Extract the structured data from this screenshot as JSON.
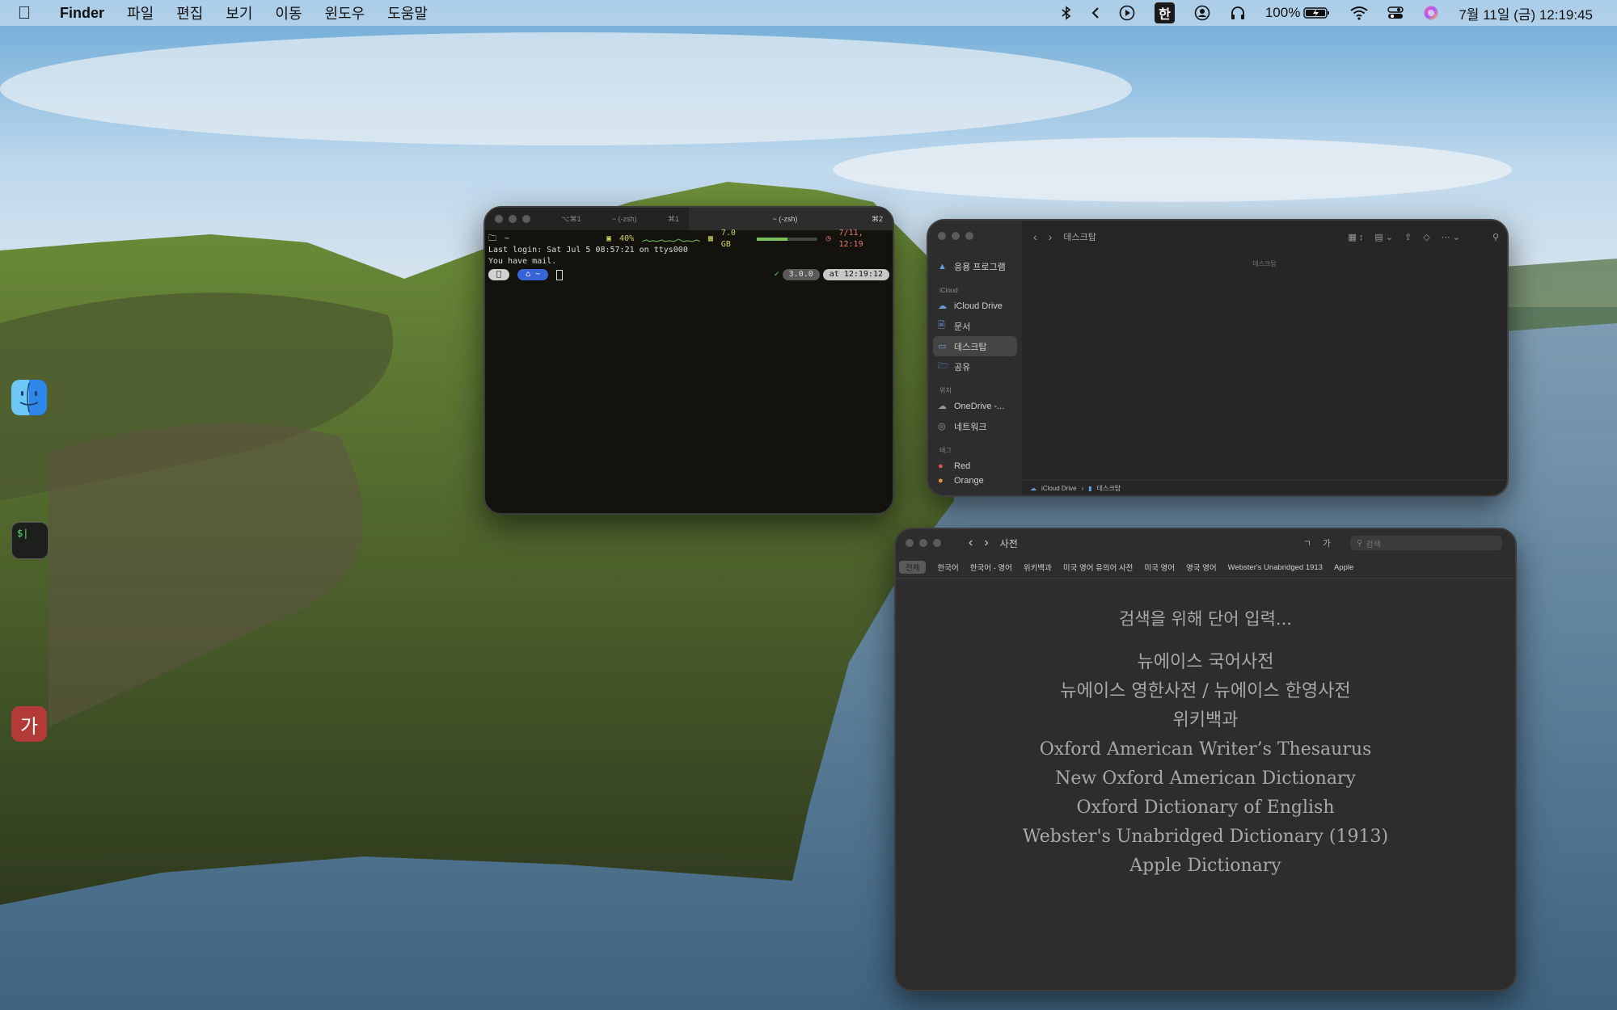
{
  "menubar": {
    "app_name": "Finder",
    "menus": [
      "파일",
      "편집",
      "보기",
      "이동",
      "윈도우",
      "도움말"
    ],
    "status": {
      "input_method": "한",
      "battery": "100%",
      "datetime": "7월 11일 (금) 12:19:45"
    }
  },
  "dock": {
    "terminal_label": "$|",
    "dictionary_label": "가"
  },
  "terminal": {
    "tab1_shortcut": "⌥⌘1",
    "tab1_title": "~ (-zsh)",
    "tab1_cmd": "⌘1",
    "tab2_title": "~ (-zsh)",
    "tab2_cmd": "⌘2",
    "status_dir": "~",
    "cpu": "40%",
    "memory": "7.0 GB",
    "memory_fraction": 0.5,
    "clock": "7/11, 12:19",
    "line1": "Last login: Sat Jul  5 08:57:21 on ttys000",
    "line2": "You have mail.",
    "prompt_path": "~",
    "version": "3.0.0",
    "time": "at 12:19:12"
  },
  "finder": {
    "title": "데스크탑",
    "column_header": "데스크탑",
    "sidebar": {
      "applications": "응용 프로그램",
      "section_icloud": "iCloud",
      "icloud_drive": "iCloud Drive",
      "documents": "문서",
      "desktop": "데스크탑",
      "shared": "공유",
      "section_locations": "위치",
      "onedrive": "OneDrive -...",
      "network": "네트워크",
      "section_tags": "태그",
      "tag_red": "Red",
      "tag_orange": "Orange"
    },
    "path": [
      "iCloud Drive",
      "데스크탑"
    ]
  },
  "dictionary": {
    "title": "사전",
    "search_placeholder": "검색",
    "font_small": "ㄱ",
    "font_large": "가",
    "scopes": [
      "전체",
      "한국어",
      "한국어 - 영어",
      "위키백과",
      "미국 영어 유의어 사전",
      "미국 영어",
      "영국 영어",
      "Webster's Unabridged 1913",
      "Apple"
    ],
    "hint": "검색을 위해 단어 입력...",
    "dictionaries": [
      "뉴에이스 국어사전",
      "뉴에이스 영한사전 / 뉴에이스 한영사전",
      "위키백과",
      "Oxford American Writer’s Thesaurus",
      "New Oxford American Dictionary",
      "Oxford Dictionary of English",
      "Webster's Unabridged Dictionary (1913)",
      "Apple Dictionary"
    ]
  }
}
